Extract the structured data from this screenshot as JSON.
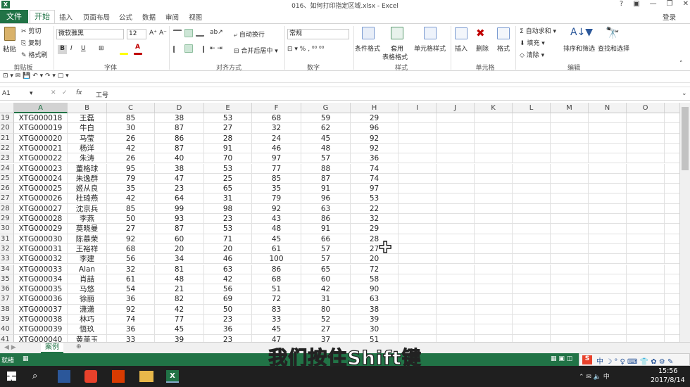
{
  "window": {
    "title": "016、如何打印指定区域.xlsx - Excel",
    "help": "?",
    "signin": "登录"
  },
  "tabs": [
    "文件",
    "开始",
    "插入",
    "页面布局",
    "公式",
    "数据",
    "审阅",
    "视图"
  ],
  "ribbon": {
    "groups": [
      "剪贴板",
      "字体",
      "对齐方式",
      "数字",
      "样式",
      "单元格",
      "编辑"
    ],
    "clipboard": {
      "paste": "粘贴",
      "cut": "剪切",
      "copy": "复制",
      "format_painter": "格式刷"
    },
    "font": {
      "name": "微软雅黑",
      "size": "12",
      "bold": "B",
      "italic": "I",
      "underline": "U"
    },
    "alignment": {
      "wrap": "自动换行",
      "merge": "合并后居中"
    },
    "number": {
      "format": "常规",
      "icons": "⊡ ▾ %  ,  ⁰⁰ ⁰⁰"
    },
    "styles": {
      "conditional": "条件格式",
      "table1": "套用",
      "table2": "表格格式",
      "cell_styles": "单元格样式"
    },
    "cells": {
      "insert": "插入",
      "delete": "删除",
      "format": "格式"
    },
    "editing": {
      "autosum": "自动求和",
      "fill": "填充",
      "clear": "清除",
      "sort": "排序和筛选",
      "find": "查找和选择"
    }
  },
  "qat": {
    "icons": "⊡ ▾  ✉  💾  ↶ ▾  ↷ ▾  ▢ ▾"
  },
  "formula": {
    "name_box": "A1",
    "content": "工号"
  },
  "columns": [
    "A",
    "B",
    "C",
    "D",
    "E",
    "F",
    "G",
    "H",
    "I",
    "J",
    "K",
    "L",
    "M",
    "N",
    "O",
    "P"
  ],
  "rows": [
    {
      "n": 19,
      "cells": [
        "XTG000018",
        "王磊",
        "85",
        "38",
        "53",
        "68",
        "59",
        "29"
      ]
    },
    {
      "n": 20,
      "cells": [
        "XTG000019",
        "牛白",
        "30",
        "87",
        "27",
        "32",
        "62",
        "96"
      ]
    },
    {
      "n": 21,
      "cells": [
        "XTG000020",
        "马莹",
        "26",
        "86",
        "28",
        "24",
        "45",
        "92"
      ]
    },
    {
      "n": 22,
      "cells": [
        "XTG000021",
        "杨洋",
        "42",
        "87",
        "91",
        "46",
        "48",
        "92"
      ]
    },
    {
      "n": 23,
      "cells": [
        "XTG000022",
        "朱涛",
        "26",
        "40",
        "70",
        "97",
        "57",
        "36"
      ]
    },
    {
      "n": 24,
      "cells": [
        "XTG000023",
        "董格球",
        "95",
        "38",
        "53",
        "77",
        "88",
        "74"
      ]
    },
    {
      "n": 25,
      "cells": [
        "XTG000024",
        "朱逸群",
        "79",
        "47",
        "25",
        "85",
        "87",
        "74"
      ]
    },
    {
      "n": 26,
      "cells": [
        "XTG000025",
        "姬从良",
        "35",
        "23",
        "65",
        "35",
        "91",
        "97"
      ]
    },
    {
      "n": 27,
      "cells": [
        "XTG000026",
        "杜琦燕",
        "42",
        "64",
        "31",
        "79",
        "96",
        "53"
      ]
    },
    {
      "n": 28,
      "cells": [
        "XTG000027",
        "沈京兵",
        "85",
        "99",
        "98",
        "92",
        "63",
        "22"
      ]
    },
    {
      "n": 29,
      "cells": [
        "XTG000028",
        "李燕",
        "50",
        "93",
        "23",
        "43",
        "86",
        "32"
      ]
    },
    {
      "n": 30,
      "cells": [
        "XTG000029",
        "莫晓曼",
        "27",
        "87",
        "53",
        "48",
        "91",
        "29"
      ]
    },
    {
      "n": 31,
      "cells": [
        "XTG000030",
        "陈慕荣",
        "92",
        "60",
        "71",
        "45",
        "66",
        "28"
      ]
    },
    {
      "n": 32,
      "cells": [
        "XTG000031",
        "王裕祥",
        "68",
        "20",
        "20",
        "61",
        "57",
        "27"
      ]
    },
    {
      "n": 33,
      "cells": [
        "XTG000032",
        "李建",
        "56",
        "34",
        "46",
        "100",
        "57",
        "20"
      ]
    },
    {
      "n": 34,
      "cells": [
        "XTG000033",
        "Alan",
        "32",
        "81",
        "63",
        "86",
        "65",
        "72"
      ]
    },
    {
      "n": 35,
      "cells": [
        "XTG000034",
        "肖喆",
        "61",
        "48",
        "42",
        "68",
        "60",
        "58"
      ]
    },
    {
      "n": 36,
      "cells": [
        "XTG000035",
        "马悠",
        "54",
        "21",
        "56",
        "51",
        "42",
        "90"
      ]
    },
    {
      "n": 37,
      "cells": [
        "XTG000036",
        "徐丽",
        "36",
        "82",
        "69",
        "72",
        "31",
        "63"
      ]
    },
    {
      "n": 38,
      "cells": [
        "XTG000037",
        "潇潇",
        "92",
        "42",
        "50",
        "83",
        "80",
        "38"
      ]
    },
    {
      "n": 39,
      "cells": [
        "XTG000038",
        "林巧",
        "74",
        "77",
        "23",
        "33",
        "52",
        "39"
      ]
    },
    {
      "n": 40,
      "cells": [
        "XTG000039",
        "悟玖",
        "36",
        "45",
        "36",
        "45",
        "27",
        "30"
      ]
    },
    {
      "n": 41,
      "cells": [
        "XTG000040",
        "黄菲玉",
        "33",
        "39",
        "23",
        "47",
        "37",
        "51"
      ]
    }
  ],
  "sheets": [
    "案例"
  ],
  "status": {
    "ready": "就绪"
  },
  "ime": {
    "logo": "S",
    "icons": "中 ☽ ° ♀ ⌨ 👕 ✿ ⚙ ✎"
  },
  "taskbar": {
    "time": "15:56",
    "date": "2017/8/14"
  },
  "subtitle": "我们按住Shift键"
}
